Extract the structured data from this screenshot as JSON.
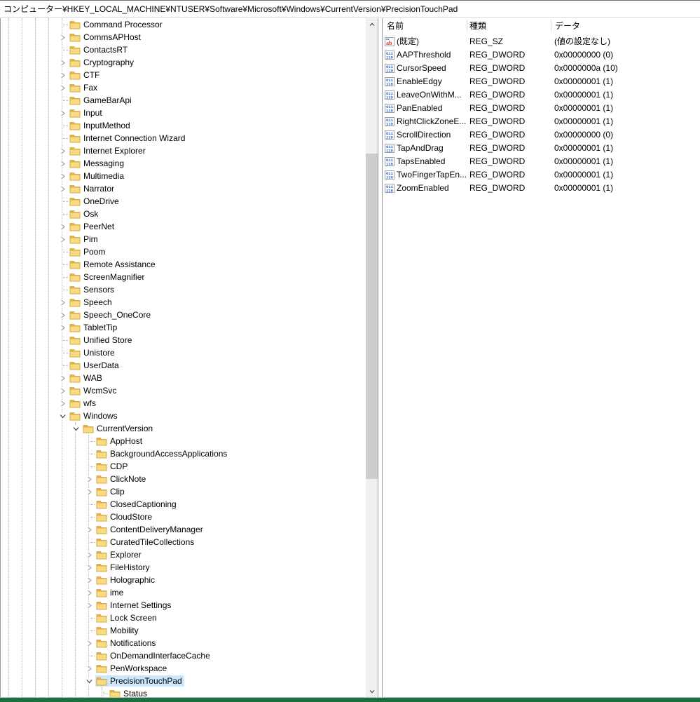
{
  "window": {
    "address_path": "コンピューター¥HKEY_LOCAL_MACHINE¥NTUSER¥Software¥Microsoft¥Windows¥CurrentVersion¥PrecisionTouchPad"
  },
  "colors": {
    "selection_highlight": "#cce8ff",
    "folder_front": "#fbdb82",
    "folder_back": "#edb13f",
    "folder_border": "#cfa23c",
    "green_bar": "#1e6e41",
    "guide_line": "#b0b0b0",
    "scroll_track": "#f0f0f0",
    "scroll_thumb": "#cdcdcd",
    "string_icon_text": "#d03a2b",
    "dword_icon_text": "#2b5fc7"
  },
  "tree": {
    "items": [
      {
        "label": "Command Processor",
        "level": 0,
        "state": "leaf",
        "selected": false
      },
      {
        "label": "CommsAPHost",
        "level": 0,
        "state": "collapsed",
        "selected": false
      },
      {
        "label": "ContactsRT",
        "level": 0,
        "state": "leaf",
        "selected": false
      },
      {
        "label": "Cryptography",
        "level": 0,
        "state": "collapsed",
        "selected": false
      },
      {
        "label": "CTF",
        "level": 0,
        "state": "collapsed",
        "selected": false
      },
      {
        "label": "Fax",
        "level": 0,
        "state": "collapsed",
        "selected": false
      },
      {
        "label": "GameBarApi",
        "level": 0,
        "state": "leaf",
        "selected": false
      },
      {
        "label": "Input",
        "level": 0,
        "state": "collapsed",
        "selected": false
      },
      {
        "label": "InputMethod",
        "level": 0,
        "state": "leaf",
        "selected": false
      },
      {
        "label": "Internet Connection Wizard",
        "level": 0,
        "state": "leaf",
        "selected": false
      },
      {
        "label": "Internet Explorer",
        "level": 0,
        "state": "collapsed",
        "selected": false
      },
      {
        "label": "Messaging",
        "level": 0,
        "state": "collapsed",
        "selected": false
      },
      {
        "label": "Multimedia",
        "level": 0,
        "state": "collapsed",
        "selected": false
      },
      {
        "label": "Narrator",
        "level": 0,
        "state": "collapsed",
        "selected": false
      },
      {
        "label": "OneDrive",
        "level": 0,
        "state": "leaf",
        "selected": false
      },
      {
        "label": "Osk",
        "level": 0,
        "state": "leaf",
        "selected": false
      },
      {
        "label": "PeerNet",
        "level": 0,
        "state": "collapsed",
        "selected": false
      },
      {
        "label": "Pim",
        "level": 0,
        "state": "collapsed",
        "selected": false
      },
      {
        "label": "Poom",
        "level": 0,
        "state": "leaf",
        "selected": false
      },
      {
        "label": "Remote Assistance",
        "level": 0,
        "state": "leaf",
        "selected": false
      },
      {
        "label": "ScreenMagnifier",
        "level": 0,
        "state": "leaf",
        "selected": false
      },
      {
        "label": "Sensors",
        "level": 0,
        "state": "leaf",
        "selected": false
      },
      {
        "label": "Speech",
        "level": 0,
        "state": "collapsed",
        "selected": false
      },
      {
        "label": "Speech_OneCore",
        "level": 0,
        "state": "collapsed",
        "selected": false
      },
      {
        "label": "TabletTip",
        "level": 0,
        "state": "collapsed",
        "selected": false
      },
      {
        "label": "Unified Store",
        "level": 0,
        "state": "leaf",
        "selected": false
      },
      {
        "label": "Unistore",
        "level": 0,
        "state": "leaf",
        "selected": false
      },
      {
        "label": "UserData",
        "level": 0,
        "state": "leaf",
        "selected": false
      },
      {
        "label": "WAB",
        "level": 0,
        "state": "collapsed",
        "selected": false
      },
      {
        "label": "WcmSvc",
        "level": 0,
        "state": "collapsed",
        "selected": false
      },
      {
        "label": "wfs",
        "level": 0,
        "state": "collapsed",
        "selected": false
      },
      {
        "label": "Windows",
        "level": 0,
        "state": "expanded",
        "selected": false
      },
      {
        "label": "CurrentVersion",
        "level": 1,
        "state": "expanded",
        "selected": false
      },
      {
        "label": "AppHost",
        "level": 2,
        "state": "leaf",
        "selected": false
      },
      {
        "label": "BackgroundAccessApplications",
        "level": 2,
        "state": "leaf",
        "selected": false
      },
      {
        "label": "CDP",
        "level": 2,
        "state": "leaf",
        "selected": false
      },
      {
        "label": "ClickNote",
        "level": 2,
        "state": "collapsed",
        "selected": false
      },
      {
        "label": "Clip",
        "level": 2,
        "state": "collapsed",
        "selected": false
      },
      {
        "label": "ClosedCaptioning",
        "level": 2,
        "state": "leaf",
        "selected": false
      },
      {
        "label": "CloudStore",
        "level": 2,
        "state": "leaf",
        "selected": false
      },
      {
        "label": "ContentDeliveryManager",
        "level": 2,
        "state": "collapsed",
        "selected": false
      },
      {
        "label": "CuratedTileCollections",
        "level": 2,
        "state": "leaf",
        "selected": false
      },
      {
        "label": "Explorer",
        "level": 2,
        "state": "collapsed",
        "selected": false
      },
      {
        "label": "FileHistory",
        "level": 2,
        "state": "collapsed",
        "selected": false
      },
      {
        "label": "Holographic",
        "level": 2,
        "state": "collapsed",
        "selected": false
      },
      {
        "label": "ime",
        "level": 2,
        "state": "collapsed",
        "selected": false
      },
      {
        "label": "Internet Settings",
        "level": 2,
        "state": "collapsed",
        "selected": false
      },
      {
        "label": "Lock Screen",
        "level": 2,
        "state": "leaf",
        "selected": false
      },
      {
        "label": "Mobility",
        "level": 2,
        "state": "leaf",
        "selected": false
      },
      {
        "label": "Notifications",
        "level": 2,
        "state": "collapsed",
        "selected": false
      },
      {
        "label": "OnDemandInterfaceCache",
        "level": 2,
        "state": "leaf",
        "selected": false
      },
      {
        "label": "PenWorkspace",
        "level": 2,
        "state": "collapsed",
        "selected": false
      },
      {
        "label": "PrecisionTouchPad",
        "level": 2,
        "state": "expanded",
        "selected": true
      },
      {
        "label": "Status",
        "level": 3,
        "state": "leaf",
        "selected": false
      }
    ]
  },
  "list": {
    "columns": [
      {
        "label": "名前"
      },
      {
        "label": "種類"
      },
      {
        "label": "データ"
      }
    ],
    "rows": [
      {
        "icon": "string",
        "name": "(既定)",
        "type": "REG_SZ",
        "data": "(値の設定なし)"
      },
      {
        "icon": "dword",
        "name": "AAPThreshold",
        "type": "REG_DWORD",
        "data": "0x00000000 (0)"
      },
      {
        "icon": "dword",
        "name": "CursorSpeed",
        "type": "REG_DWORD",
        "data": "0x0000000a (10)"
      },
      {
        "icon": "dword",
        "name": "EnableEdgy",
        "type": "REG_DWORD",
        "data": "0x00000001 (1)"
      },
      {
        "icon": "dword",
        "name": "LeaveOnWithM...",
        "type": "REG_DWORD",
        "data": "0x00000001 (1)"
      },
      {
        "icon": "dword",
        "name": "PanEnabled",
        "type": "REG_DWORD",
        "data": "0x00000001 (1)"
      },
      {
        "icon": "dword",
        "name": "RightClickZoneE...",
        "type": "REG_DWORD",
        "data": "0x00000001 (1)"
      },
      {
        "icon": "dword",
        "name": "ScrollDirection",
        "type": "REG_DWORD",
        "data": "0x00000000 (0)"
      },
      {
        "icon": "dword",
        "name": "TapAndDrag",
        "type": "REG_DWORD",
        "data": "0x00000001 (1)"
      },
      {
        "icon": "dword",
        "name": "TapsEnabled",
        "type": "REG_DWORD",
        "data": "0x00000001 (1)"
      },
      {
        "icon": "dword",
        "name": "TwoFingerTapEn...",
        "type": "REG_DWORD",
        "data": "0x00000001 (1)"
      },
      {
        "icon": "dword",
        "name": "ZoomEnabled",
        "type": "REG_DWORD",
        "data": "0x00000001 (1)"
      }
    ]
  }
}
